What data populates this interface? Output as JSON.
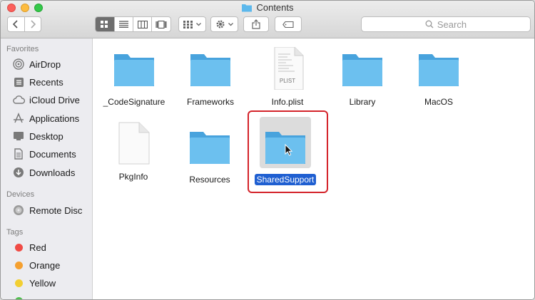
{
  "window": {
    "title": "Contents"
  },
  "colors": {
    "selection": "#1f5fd1",
    "highlight_box": "#d4232a",
    "folder": "#5cb8ec"
  },
  "search": {
    "placeholder": "Search"
  },
  "sidebar": {
    "favorites_header": "Favorites",
    "favorites": [
      {
        "label": "AirDrop",
        "icon": "airdrop-icon"
      },
      {
        "label": "Recents",
        "icon": "recents-icon"
      },
      {
        "label": "iCloud Drive",
        "icon": "cloud-icon"
      },
      {
        "label": "Applications",
        "icon": "applications-icon"
      },
      {
        "label": "Desktop",
        "icon": "desktop-icon"
      },
      {
        "label": "Documents",
        "icon": "documents-icon"
      },
      {
        "label": "Downloads",
        "icon": "downloads-icon"
      }
    ],
    "devices_header": "Devices",
    "devices": [
      {
        "label": "Remote Disc",
        "icon": "disc-icon"
      }
    ],
    "tags_header": "Tags",
    "tags": [
      {
        "label": "Red",
        "color": "#f04b45"
      },
      {
        "label": "Orange",
        "color": "#f5a030"
      },
      {
        "label": "Yellow",
        "color": "#f2cf32"
      }
    ]
  },
  "files": [
    {
      "name": "_CodeSignature",
      "type": "folder"
    },
    {
      "name": "Frameworks",
      "type": "folder"
    },
    {
      "name": "Info.plist",
      "type": "plist",
      "badge": "PLIST"
    },
    {
      "name": "Library",
      "type": "folder"
    },
    {
      "name": "MacOS",
      "type": "folder"
    },
    {
      "name": "PkgInfo",
      "type": "document"
    },
    {
      "name": "Resources",
      "type": "folder"
    },
    {
      "name": "SharedSupport",
      "type": "folder",
      "selected": true
    }
  ]
}
